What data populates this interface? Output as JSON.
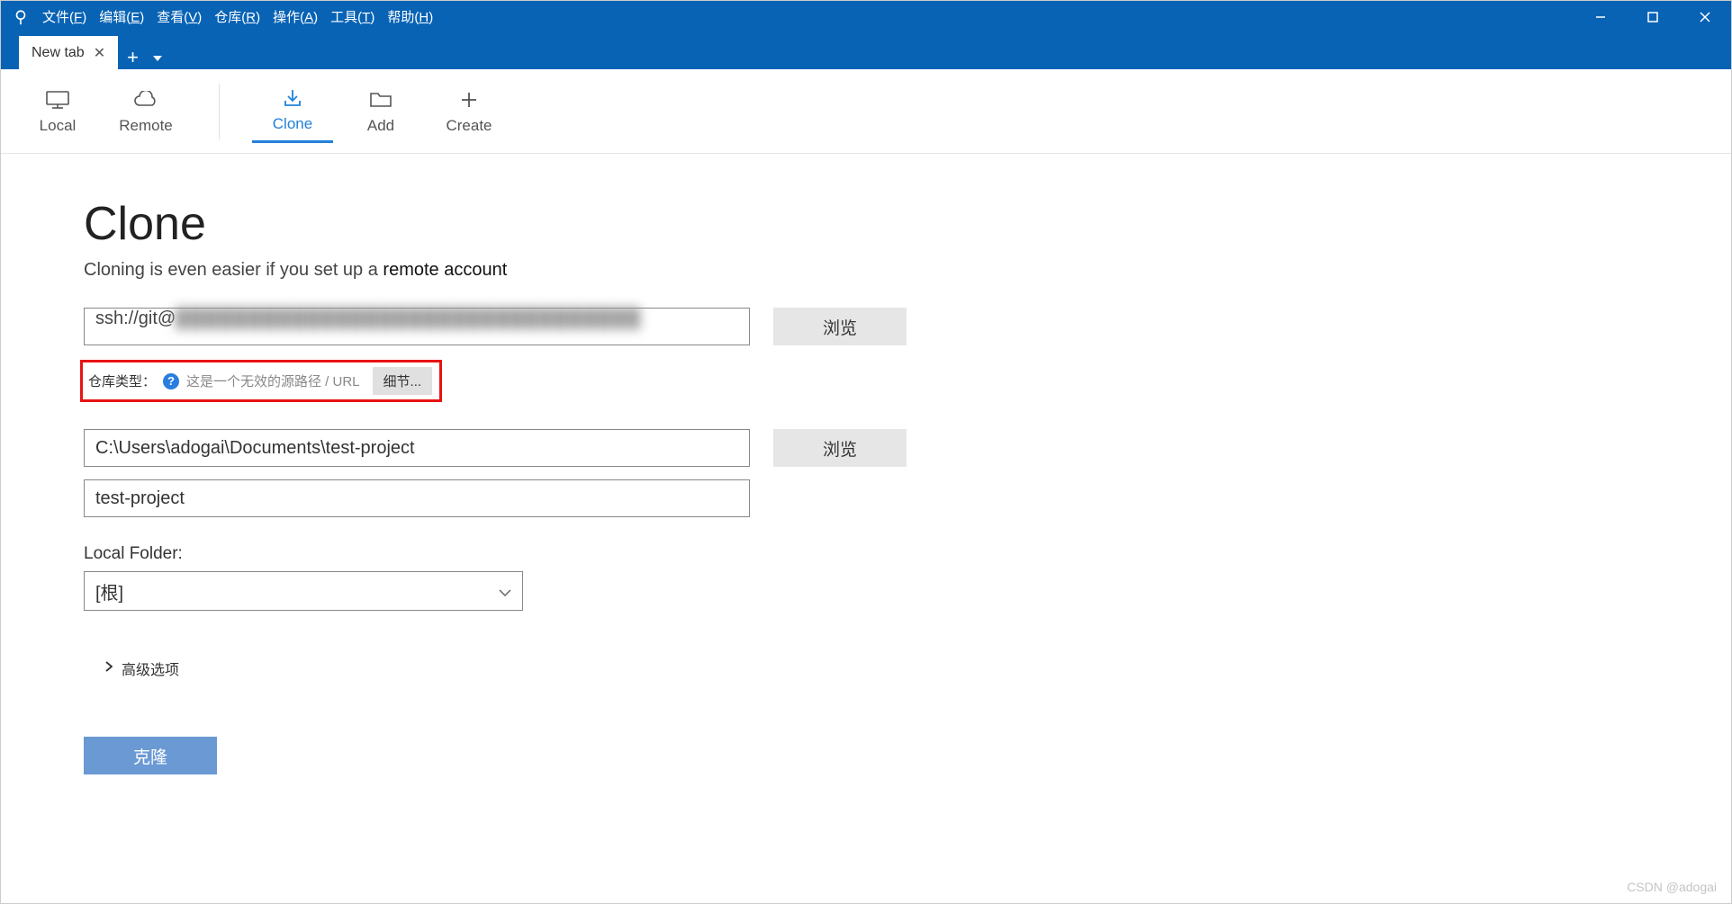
{
  "menubar": {
    "items": [
      {
        "label": "文件",
        "key": "F"
      },
      {
        "label": "编辑",
        "key": "E"
      },
      {
        "label": "查看",
        "key": "V"
      },
      {
        "label": "仓库",
        "key": "R"
      },
      {
        "label": "操作",
        "key": "A"
      },
      {
        "label": "工具",
        "key": "T"
      },
      {
        "label": "帮助",
        "key": "H"
      }
    ]
  },
  "tabs": {
    "active_label": "New tab"
  },
  "toolbar": {
    "local": "Local",
    "remote": "Remote",
    "clone": "Clone",
    "add": "Add",
    "create": "Create"
  },
  "page": {
    "title": "Clone",
    "subtitle_prefix": "Cloning is even easier if you set up a ",
    "subtitle_link": "remote account",
    "source_prefix": "ssh://git@",
    "source_blurred": "████████████████████████████████",
    "browse": "浏览",
    "repo_type_label": "仓库类型：",
    "repo_type_msg": "这是一个无效的源路径 / URL",
    "details_btn": "细节...",
    "dest_path": "C:\\Users\\adogai\\Documents\\test-project",
    "name": "test-project",
    "local_folder_label": "Local Folder:",
    "local_folder_value": "[根]",
    "advanced": "高级选项",
    "submit": "克隆"
  },
  "watermark": "CSDN @adogai"
}
